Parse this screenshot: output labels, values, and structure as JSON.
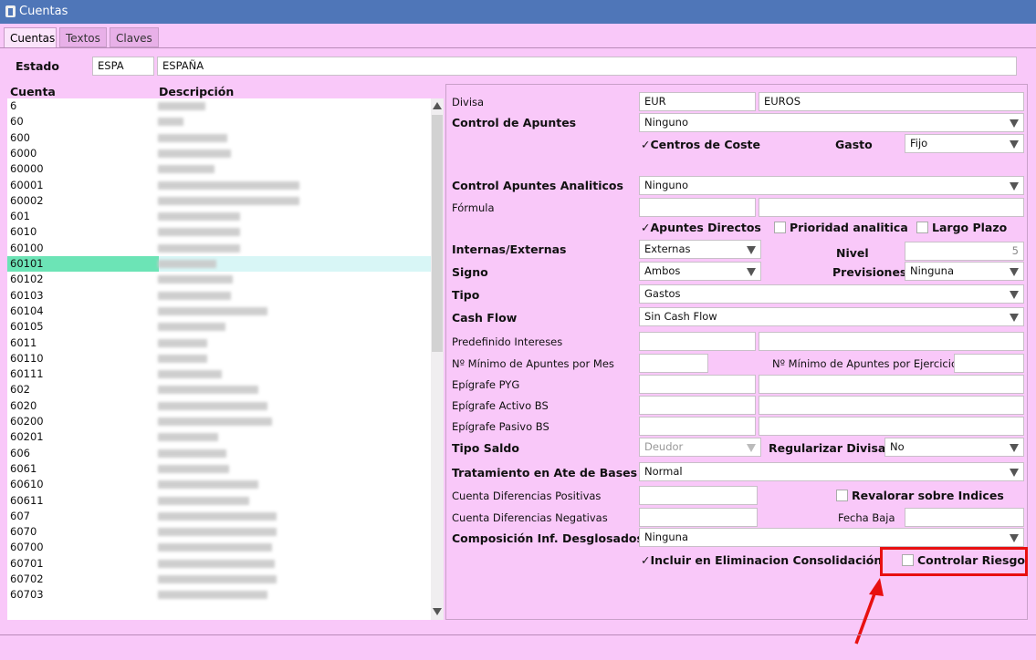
{
  "window": {
    "title": "Cuentas"
  },
  "tabs": [
    "Cuentas",
    "Textos",
    "Claves"
  ],
  "estado": {
    "label": "Estado",
    "code": "ESPA",
    "name": "ESPAÑA"
  },
  "list": {
    "col_cuenta": "Cuenta",
    "col_descripcion": "Descripción",
    "selected": "60101",
    "rows": [
      "6",
      "60",
      "600",
      "6000",
      "60000",
      "60001",
      "60002",
      "601",
      "6010",
      "60100",
      "60101",
      "60102",
      "60103",
      "60104",
      "60105",
      "6011",
      "60110",
      "60111",
      "602",
      "6020",
      "60200",
      "60201",
      "606",
      "6061",
      "60610",
      "60611",
      "607",
      "6070",
      "60700",
      "60701",
      "60702",
      "60703"
    ]
  },
  "form": {
    "divisa": {
      "label": "Divisa",
      "code": "EUR",
      "name": "EUROS"
    },
    "control_apuntes": {
      "label": "Control de Apuntes",
      "value": "Ninguno"
    },
    "centros_coste": {
      "label": "Centros de Coste",
      "checked": true
    },
    "gasto": {
      "label": "Gasto",
      "value": "Fijo"
    },
    "control_analiticos": {
      "label": "Control Apuntes Analiticos",
      "value": "Ninguno"
    },
    "formula": {
      "label": "Fórmula"
    },
    "apuntes_directos": {
      "label": "Apuntes Directos",
      "checked": true
    },
    "prioridad_analitica": {
      "label": "Prioridad analitica",
      "checked": false
    },
    "largo_plazo": {
      "label": "Largo Plazo",
      "checked": false
    },
    "internas_externas": {
      "label": "Internas/Externas",
      "value": "Externas"
    },
    "nivel": {
      "label": "Nivel",
      "value": "5"
    },
    "signo": {
      "label": "Signo",
      "value": "Ambos"
    },
    "previsiones": {
      "label": "Previsiones",
      "value": "Ninguna"
    },
    "tipo": {
      "label": "Tipo",
      "value": "Gastos"
    },
    "cash_flow": {
      "label": "Cash Flow",
      "value": "Sin Cash Flow"
    },
    "predefinido_intereses": {
      "label": "Predefinido Intereses"
    },
    "min_apuntes_mes": {
      "label": "Nº Mínimo de Apuntes por Mes"
    },
    "min_apuntes_ejercicio": {
      "label": "Nº Mínimo de Apuntes por Ejercicio"
    },
    "epigrafe_pyg": {
      "label": "Epígrafe PYG"
    },
    "epigrafe_activo": {
      "label": "Epígrafe Activo BS"
    },
    "epigrafe_pasivo": {
      "label": "Epígrafe Pasivo BS"
    },
    "tipo_saldo": {
      "label": "Tipo Saldo",
      "value": "Deudor"
    },
    "regularizar_divisas": {
      "label": "Regularizar Divisas",
      "value": "No"
    },
    "tratamiento": {
      "label": "Tratamiento en Ate de Bases",
      "value": "Normal"
    },
    "dif_positivas": {
      "label": "Cuenta Diferencias Positivas"
    },
    "revalorar": {
      "label": "Revalorar sobre Indices",
      "checked": false
    },
    "dif_negativas": {
      "label": "Cuenta Diferencias Negativas"
    },
    "fecha_baja": {
      "label": "Fecha Baja"
    },
    "composicion": {
      "label": "Composición Inf. Desglosados",
      "value": "Ninguna"
    },
    "incluir_eliminacion": {
      "label": "Incluir en Eliminacion Consolidación",
      "checked": true
    },
    "controlar_riesgo": {
      "label": "Controlar Riesgo",
      "checked": false
    }
  },
  "colors": {
    "background": "#f9c8f9",
    "titlebar": "#4f76b8",
    "selection": "#6ce4b6",
    "highlight": "#e81010"
  }
}
